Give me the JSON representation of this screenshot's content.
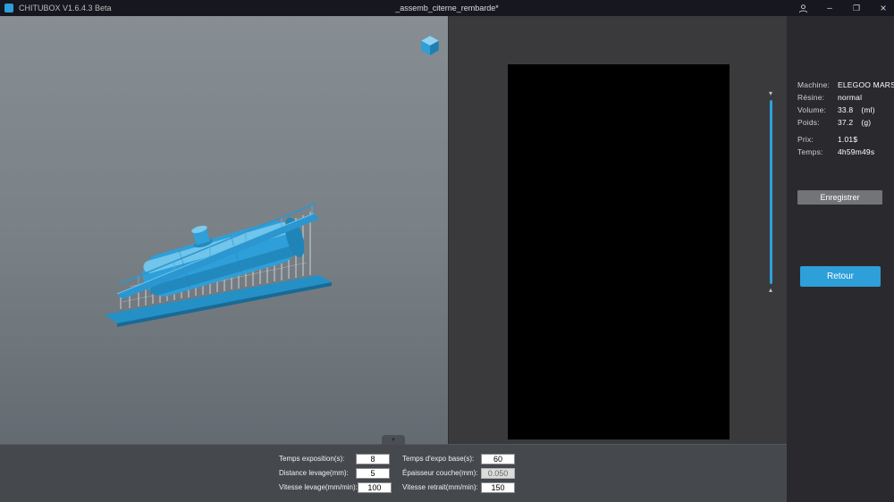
{
  "colors": {
    "accent": "#2e9fd9",
    "titlebar": "#17171f",
    "viewport_top": "#868d93",
    "viewport_bottom": "#5e646b",
    "panel_dark": "#3a3a3d",
    "sidebar": "#2a2a2e",
    "bottom_bar": "#45484d",
    "button_gray": "#737478"
  },
  "titlebar": {
    "app_title": "CHITUBOX V1.6.4.3 Beta",
    "document_title": "_assemb_citerne_rembarde*",
    "minimize_glyph": "–",
    "maximize_glyph": "❐",
    "close_glyph": "×"
  },
  "preview": {
    "slider_down_glyph": "▾",
    "slider_up_glyph": "▴"
  },
  "info_panel": {
    "rows": [
      {
        "label": "Machine:",
        "value": "ELEGOO MARS",
        "unit": ""
      },
      {
        "label": "Résine:",
        "value": "normal",
        "unit": ""
      },
      {
        "label": "Volume:",
        "value": "33.8",
        "unit": "(ml)"
      },
      {
        "label": "Poids:",
        "value": "37.2",
        "unit": "(g)"
      },
      {
        "label": "Prix:",
        "value": "1.01$",
        "unit": ""
      },
      {
        "label": "Temps:",
        "value": "4h59m49s",
        "unit": ""
      }
    ],
    "save_button": "Enregistrer",
    "back_button": "Retour"
  },
  "params_panel": {
    "collapse_glyph": "▼",
    "left": [
      {
        "label": "Temps exposition(s):",
        "value": "8"
      },
      {
        "label": "Distance levage(mm):",
        "value": "5"
      },
      {
        "label": "Vitesse levage(mm/min):",
        "value": "100"
      }
    ],
    "right": [
      {
        "label": "Temps d'expo base(s):",
        "value": "60"
      },
      {
        "label": "Épaisseur couche(mm):",
        "value": "0.050"
      },
      {
        "label": "Vitesse retrait(mm/min):",
        "value": "150"
      }
    ]
  }
}
